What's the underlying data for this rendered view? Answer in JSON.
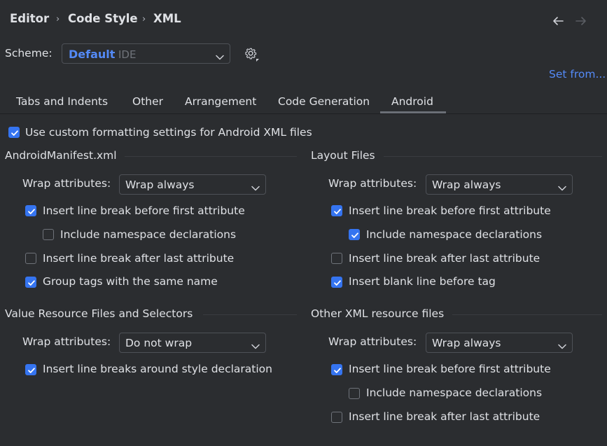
{
  "breadcrumb": {
    "item1": "Editor",
    "item2": "Code Style",
    "item3": "XML",
    "separator": "›"
  },
  "nav": {
    "back_icon": "arrow-left-icon",
    "forward_icon": "arrow-right-icon"
  },
  "scheme": {
    "label": "Scheme:",
    "name": "Default",
    "type": "IDE",
    "settings_icon": "gear-icon"
  },
  "set_from": "Set from...",
  "tabs": [
    {
      "label": "Tabs and Indents"
    },
    {
      "label": "Other"
    },
    {
      "label": "Arrangement"
    },
    {
      "label": "Code Generation"
    },
    {
      "label": "Android",
      "selected": true
    }
  ],
  "use_custom": {
    "label": "Use custom formatting settings for Android XML files",
    "checked": true
  },
  "manifest": {
    "title": "AndroidManifest.xml",
    "wrap_label": "Wrap attributes:",
    "wrap_value": "Wrap always",
    "options": [
      {
        "label": "Insert line break before first attribute",
        "checked": true
      },
      {
        "label": "Include namespace declarations",
        "checked": false
      },
      {
        "label": "Insert line break after last attribute",
        "checked": false
      },
      {
        "label": "Group tags with the same name",
        "checked": true
      }
    ]
  },
  "layout": {
    "title": "Layout Files",
    "wrap_label": "Wrap attributes:",
    "wrap_value": "Wrap always",
    "options": [
      {
        "label": "Insert line break before first attribute",
        "checked": true
      },
      {
        "label": "Include namespace declarations",
        "checked": true
      },
      {
        "label": "Insert line break after last attribute",
        "checked": false
      },
      {
        "label": "Insert blank line before tag",
        "checked": true
      }
    ]
  },
  "values": {
    "title": "Value Resource Files and Selectors",
    "wrap_label": "Wrap attributes:",
    "wrap_value": "Do not wrap",
    "options": [
      {
        "label": "Insert line breaks around style declaration",
        "checked": true
      }
    ]
  },
  "other_xml": {
    "title": "Other XML resource files",
    "wrap_label": "Wrap attributes:",
    "wrap_value": "Wrap always",
    "options": [
      {
        "label": "Insert line break before first attribute",
        "checked": true
      },
      {
        "label": "Include namespace declarations",
        "checked": false
      },
      {
        "label": "Insert line break after last attribute",
        "checked": false
      }
    ]
  },
  "colors": {
    "accent": "#3574f0",
    "link": "#548af7",
    "background": "#2b2d30",
    "text": "#dfe1e5"
  }
}
